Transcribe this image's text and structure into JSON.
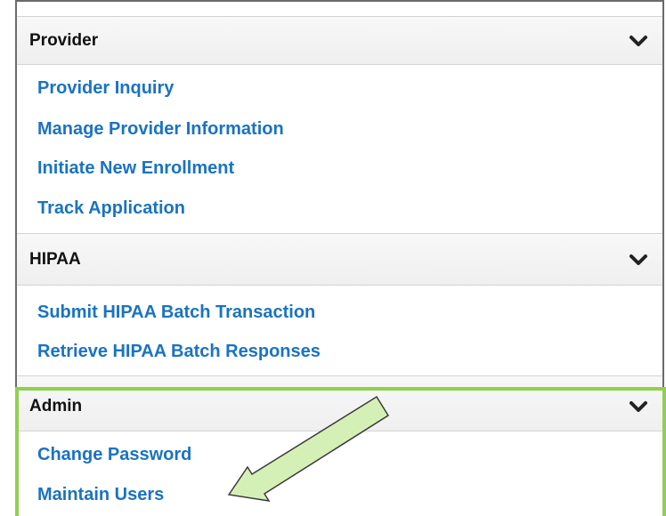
{
  "sections": [
    {
      "title": "Provider",
      "chevron_icon": "chevron-down-icon",
      "links": [
        "Provider Inquiry",
        "Manage Provider Information",
        "Initiate New Enrollment",
        "Track Application"
      ]
    },
    {
      "title": "HIPAA",
      "chevron_icon": "chevron-down-icon",
      "links": [
        "Submit HIPAA Batch Transaction",
        "Retrieve HIPAA Batch Responses"
      ]
    },
    {
      "title": "Admin",
      "chevron_icon": "chevron-down-icon",
      "links": [
        "Change Password",
        "Maintain Users"
      ]
    }
  ],
  "colors": {
    "link": "#1a73c1",
    "highlight": "#8fd14f",
    "arrow_fill": "#d5f0b6",
    "arrow_stroke": "#3a3a3a"
  },
  "annotations": {
    "highlight_box": "admin-section",
    "arrow_target": "Maintain Users"
  }
}
